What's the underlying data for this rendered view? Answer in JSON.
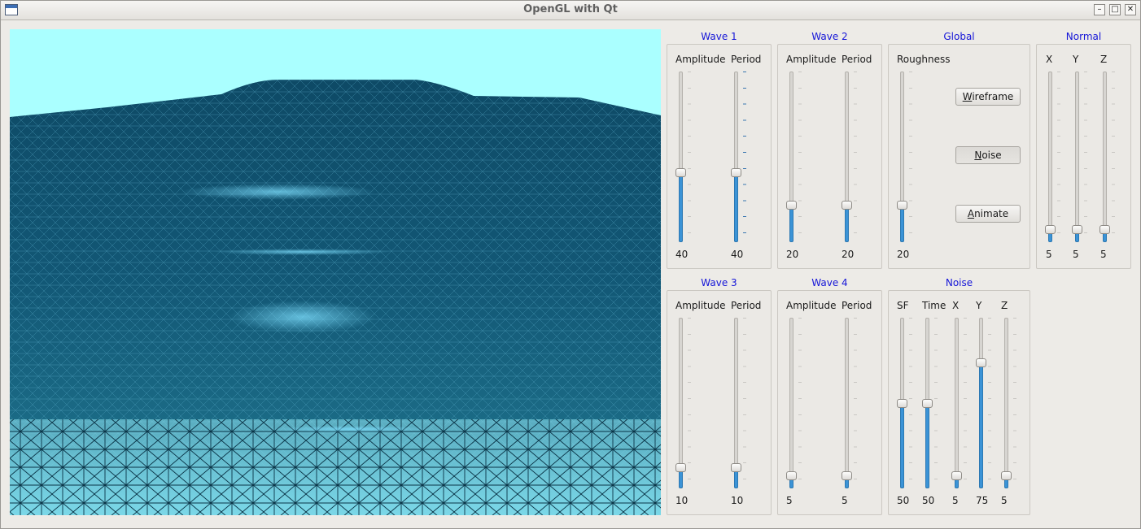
{
  "window": {
    "title": "OpenGL with Qt",
    "minimize_label": "–",
    "maximize_label": "□",
    "close_label": "✕"
  },
  "colors": {
    "accent": "#3b93d6",
    "group_title": "#1515d8",
    "sky": "#aaffff",
    "terrain": "#0c4a66"
  },
  "groups": {
    "wave1": {
      "title": "Wave 1",
      "amplitude_label": "Amplitude",
      "period_label": "Period",
      "amplitude": "40",
      "period": "40"
    },
    "wave2": {
      "title": "Wave 2",
      "amplitude_label": "Amplitude",
      "period_label": "Period",
      "amplitude": "20",
      "period": "20"
    },
    "global": {
      "title": "Global",
      "roughness_label": "Roughness",
      "roughness": "20",
      "wireframe_first": "W",
      "wireframe_rest": "ireframe",
      "noise_first": "N",
      "noise_rest": "oise",
      "animate_first": "A",
      "animate_rest": "nimate"
    },
    "normal": {
      "title": "Normal",
      "x_label": "X",
      "y_label": "Y",
      "z_label": "Z",
      "x": "5",
      "y": "5",
      "z": "5"
    },
    "wave3": {
      "title": "Wave 3",
      "amplitude_label": "Amplitude",
      "period_label": "Period",
      "amplitude": "10",
      "period": "10"
    },
    "wave4": {
      "title": "Wave 4",
      "amplitude_label": "Amplitude",
      "period_label": "Period",
      "amplitude": "5",
      "period": "5"
    },
    "noise": {
      "title": "Noise",
      "sf_label": "SF",
      "time_label": "Time",
      "x_label": "X",
      "y_label": "Y",
      "z_label": "Z",
      "sf": "50",
      "time": "50",
      "x": "5",
      "y": "75",
      "z": "5"
    }
  },
  "slider_levels": {
    "wave1_amplitude": 0.4,
    "wave1_period": 0.4,
    "wave2_amplitude": 0.2,
    "wave2_period": 0.2,
    "global_roughness": 0.2,
    "normal_x": 0.05,
    "normal_y": 0.05,
    "normal_z": 0.05,
    "wave3_amplitude": 0.1,
    "wave3_period": 0.1,
    "wave4_amplitude": 0.05,
    "wave4_period": 0.05,
    "noise_sf": 0.5,
    "noise_time": 0.5,
    "noise_x": 0.05,
    "noise_y": 0.75,
    "noise_z": 0.05
  }
}
